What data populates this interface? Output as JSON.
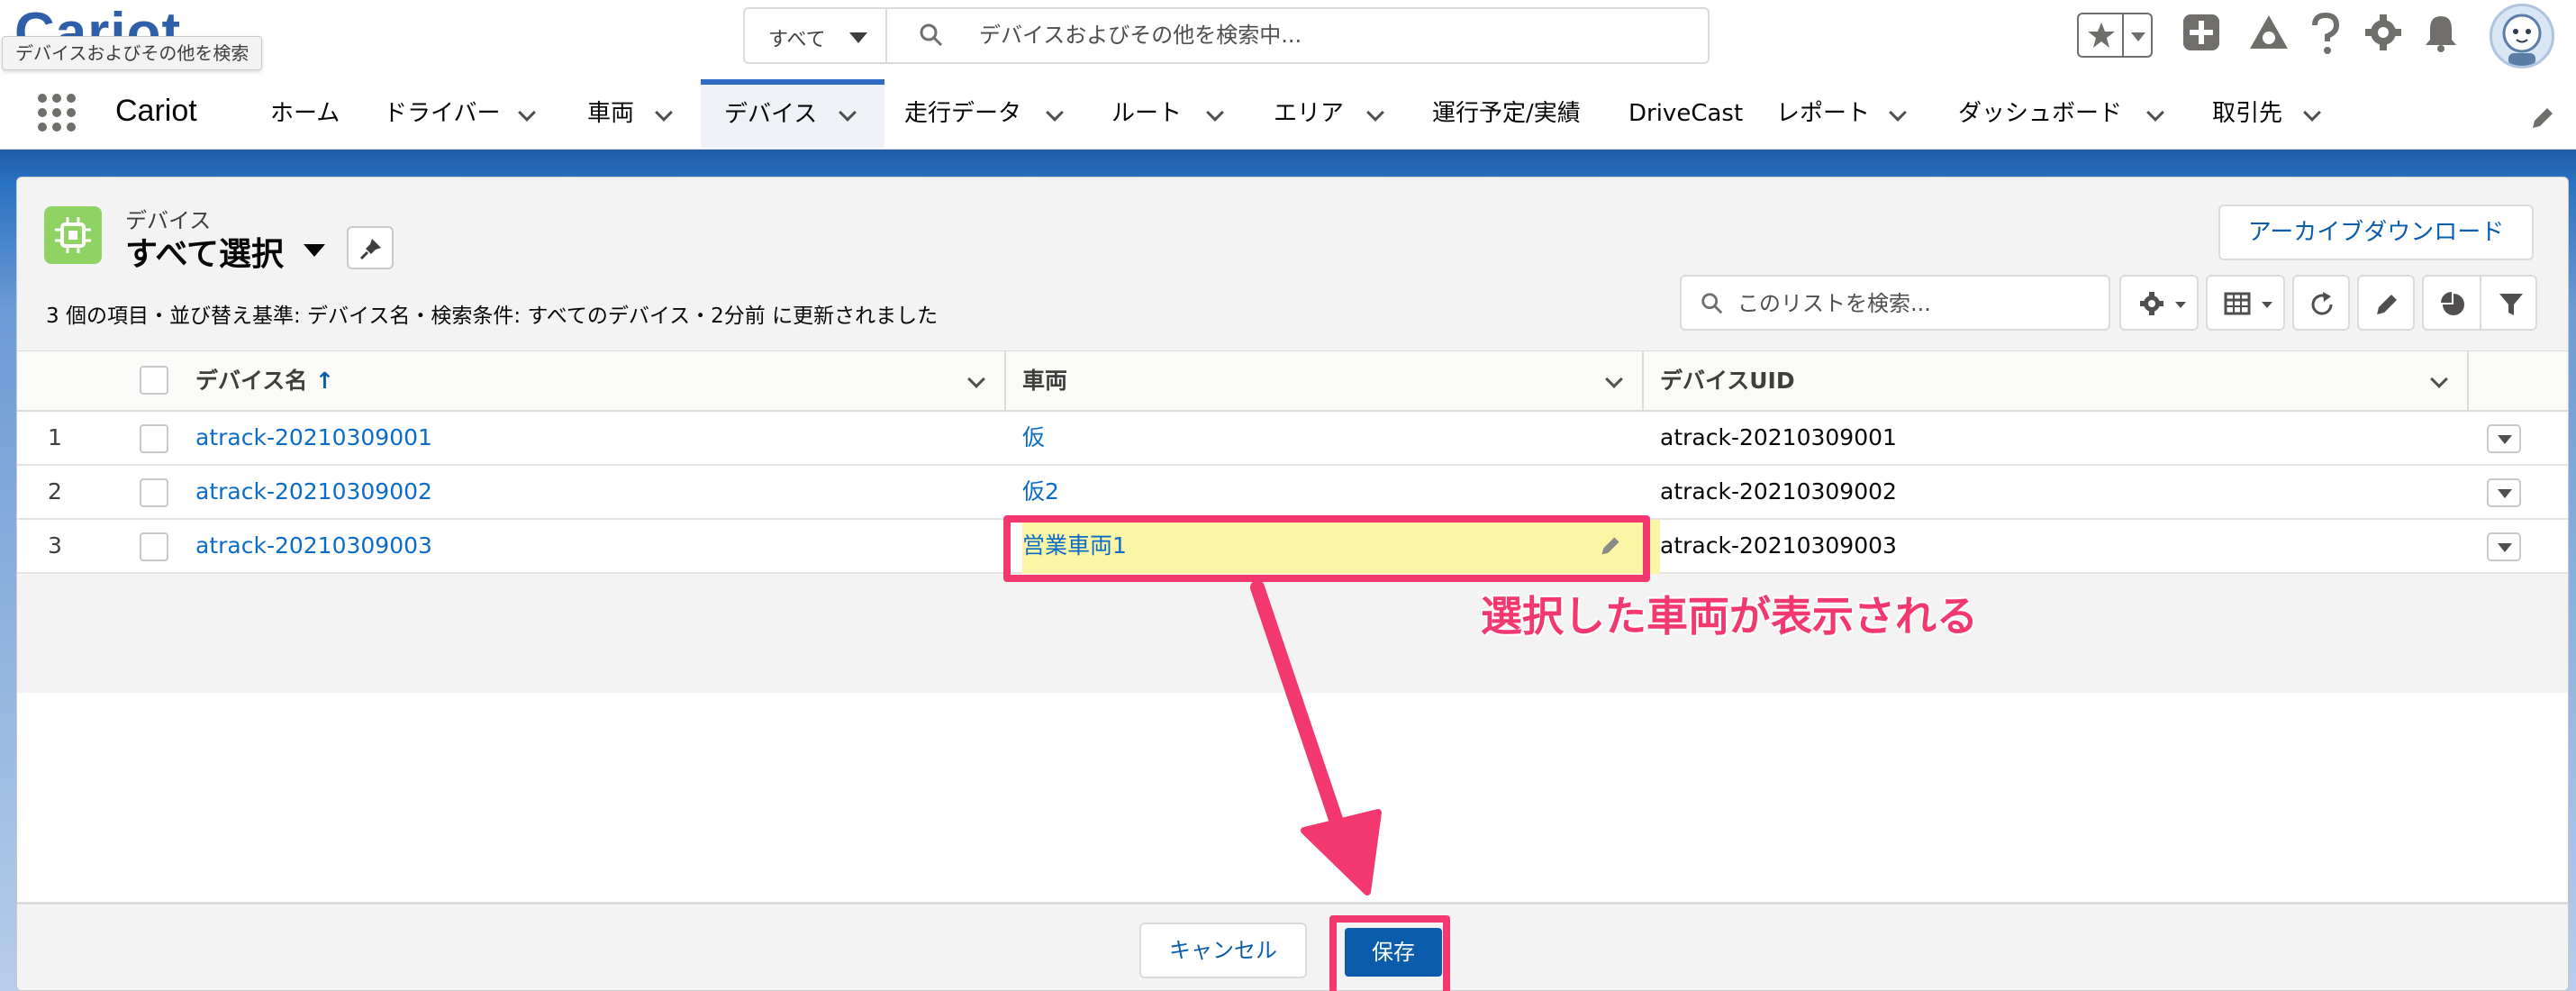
{
  "header": {
    "logo_text": "Cariot",
    "tooltip": "デバイスおよびその他を検索",
    "search_scope": "すべて",
    "search_placeholder": "デバイスおよびその他を検索中..."
  },
  "nav": {
    "app_name": "Cariot",
    "tabs": [
      {
        "label": "ホーム",
        "has_menu": false
      },
      {
        "label": "ドライバー",
        "has_menu": true
      },
      {
        "label": "車両",
        "has_menu": true
      },
      {
        "label": "デバイス",
        "has_menu": true,
        "active": true
      },
      {
        "label": "走行データ",
        "has_menu": true
      },
      {
        "label": "ルート",
        "has_menu": true
      },
      {
        "label": "エリア",
        "has_menu": true
      },
      {
        "label": "運行予定/実績",
        "has_menu": false
      },
      {
        "label": "DriveCast",
        "has_menu": false
      },
      {
        "label": "レポート",
        "has_menu": true
      },
      {
        "label": "ダッシュボード",
        "has_menu": true
      },
      {
        "label": "取引先",
        "has_menu": true
      }
    ]
  },
  "list": {
    "object_label": "デバイス",
    "view_name": "すべて選択",
    "archive_button": "アーカイブダウンロード",
    "summary": "3 個の項目・並び替え基準: デバイス名・検索条件: すべてのデバイス・2分前 に更新されました",
    "search_placeholder": "このリストを検索...",
    "columns": [
      "デバイス名",
      "車両",
      "デバイスUID"
    ],
    "sort_indicator": "↑",
    "rows": [
      {
        "num": "1",
        "name": "atrack-20210309001",
        "vehicle": "仮",
        "uid": "atrack-20210309001"
      },
      {
        "num": "2",
        "name": "atrack-20210309002",
        "vehicle": "仮2",
        "uid": "atrack-20210309002"
      },
      {
        "num": "3",
        "name": "atrack-20210309003",
        "vehicle": "営業車両1",
        "uid": "atrack-20210309003",
        "edited": true
      }
    ]
  },
  "footer": {
    "cancel_label": "キャンセル",
    "save_label": "保存"
  },
  "annotation": {
    "callout": "選択した車両が表示される",
    "color": "#f2386f"
  },
  "colors": {
    "brand_blue": "#0b5cab",
    "link": "#0b6cc8",
    "edited_cell": "#fbf6a6",
    "object_icon": "#8ed363"
  }
}
